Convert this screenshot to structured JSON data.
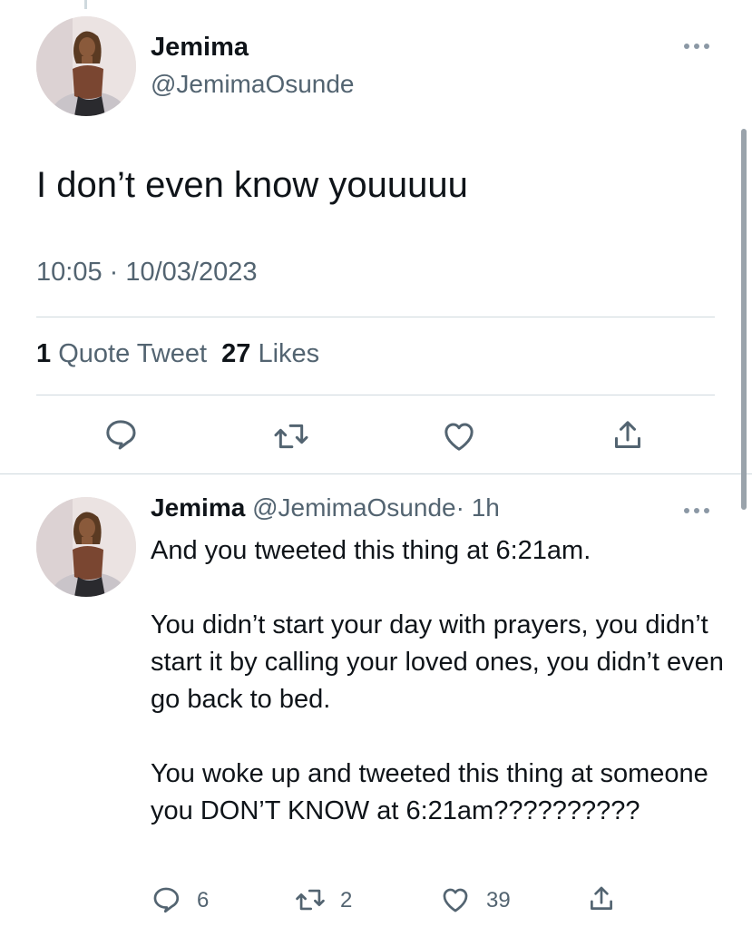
{
  "main_tweet": {
    "author_name": "Jemima",
    "author_handle": "@JemimaOsunde",
    "text": "I don’t even know youuuuu",
    "timestamp": "10:05 · 10/03/2023",
    "quote_count": "1",
    "quote_label": "Quote Tweet",
    "like_count": "27",
    "like_label": "Likes"
  },
  "reply_tweet": {
    "author_name": "Jemima",
    "author_handle": "@JemimaOsunde",
    "time": "· 1h",
    "text": "And you tweeted this thing at 6:21am.\n\nYou didn’t start your day with prayers, you didn’t start it by calling your loved ones, you didn’t even go back to bed.\n\nYou woke up and tweeted this thing at someone you DON’T KNOW at 6:21am??????????",
    "reply_count": "6",
    "retweet_count": "2",
    "like_count": "39"
  },
  "icons": [
    "reply-icon",
    "retweet-icon",
    "like-icon",
    "share-icon",
    "more-icon"
  ],
  "colors": {
    "text": "#0f1419",
    "secondary": "#536471",
    "divider": "#cfd9de",
    "icon": "#536471"
  }
}
